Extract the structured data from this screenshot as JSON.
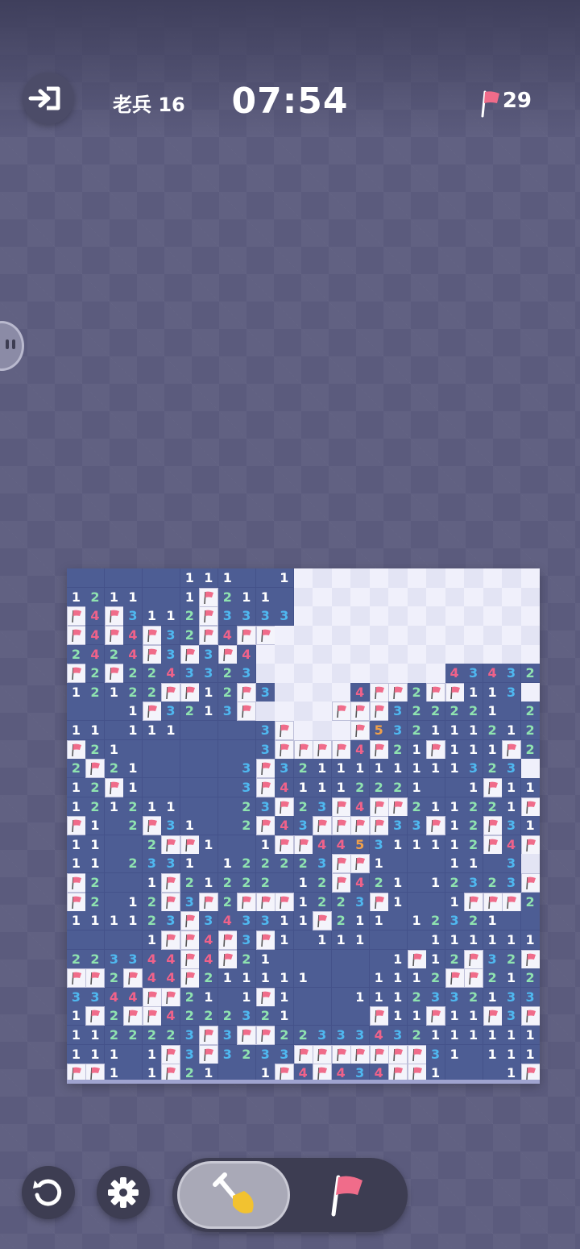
{
  "header": {
    "level": "老兵 16",
    "timer": "07:54",
    "flags_remaining": "29"
  },
  "colors": {
    "1": "#ffffff",
    "2": "#8fe3b0",
    "3": "#4fb8f0",
    "4": "#f0628a",
    "5": "#f0a04a",
    "flag": "#f06c8a"
  },
  "board": {
    "cols": 25,
    "rows": 27,
    "legend": "row strings: 0=open empty, 1-5=number, F=flag, .=unrevealed",
    "grid": [
      "000000111001.............",
      "1211001F2110.............",
      "F4F3112F3333.............",
      "F4F4F32F4FF..............",
      "2424F3F3F4...............",
      "F2F2243323..........4343222FF",
      "12122FF12F3....4FF2FF113",
      "0001F3213F....FFF32222102F",
      "11011100003F...F5321112124F",
      "F2100000003FFFF4F21F111F2FFF",
      "2F21000003F3211111111323",
      "12F1000003F41112221001F111",
      "12121100023F23F4FF211221F",
      "F102F31002F43FFFF33F12F3121",
      "11002FF1001FF445311112F4F2",
      "11023310122223FF10001103",
      "F2001F21222012F421012323F2",
      "F2012F3F2FFF1223F1001FFF211",
      "111123F343311F21101232100",
      "00001FF4F3F10111000111111111",
      "223344F4F210000001F12F32F1",
      "FF2F44F2111110001112FF2121",
      "3344FF2101F10001112332133F",
      "1F2FF42223210000F11F11F3F",
      "1122223F3FF22333432111111221",
      "11101F3F3233FFFFFFF31011110",
      "FF101F21001F4F434FF10001F10"
    ]
  }
}
